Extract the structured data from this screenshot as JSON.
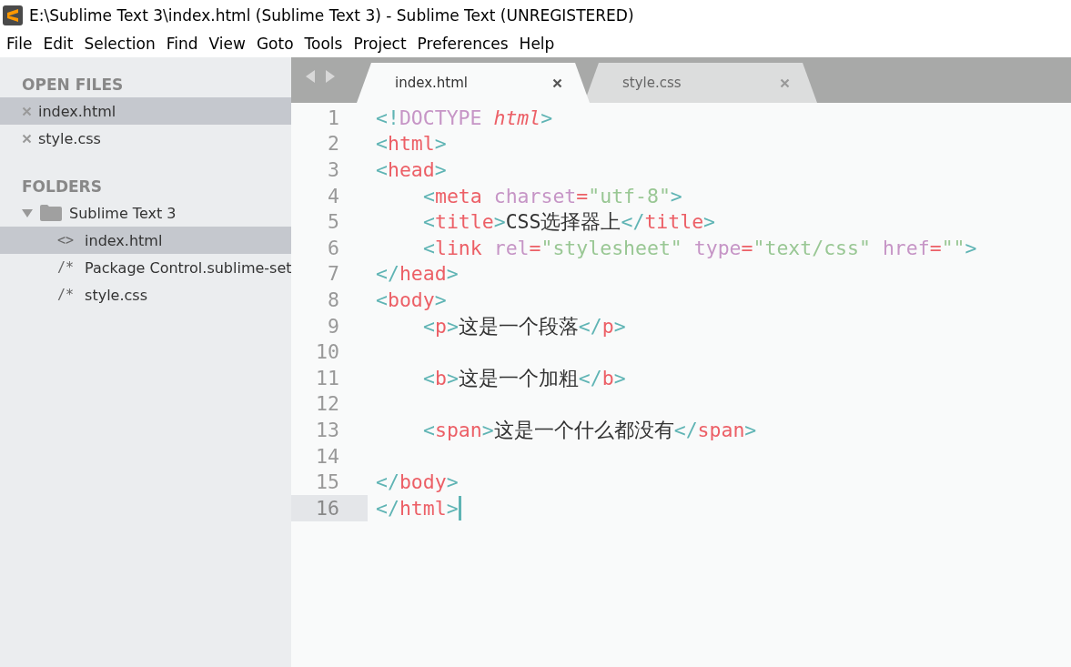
{
  "window": {
    "title": "E:\\Sublime Text 3\\index.html (Sublime Text 3) - Sublime Text (UNREGISTERED)"
  },
  "menu": [
    "File",
    "Edit",
    "Selection",
    "Find",
    "View",
    "Goto",
    "Tools",
    "Project",
    "Preferences",
    "Help"
  ],
  "sidebar": {
    "open_files": {
      "heading": "OPEN FILES",
      "items": [
        {
          "name": "index.html",
          "selected": true
        },
        {
          "name": "style.css",
          "selected": false
        }
      ]
    },
    "folders": {
      "heading": "FOLDERS",
      "items": [
        {
          "name": "Sublime Text 3",
          "expanded": true,
          "children": [
            {
              "name": "index.html",
              "icon": "<>",
              "selected": true
            },
            {
              "name": "Package Control.sublime-set",
              "icon": "/*",
              "selected": false
            },
            {
              "name": "style.css",
              "icon": "/*",
              "selected": false
            }
          ]
        }
      ]
    }
  },
  "tabs": [
    {
      "label": "index.html",
      "selected": true
    },
    {
      "label": "style.css",
      "selected": false
    }
  ],
  "editor": {
    "lines": [
      {
        "number": "1",
        "indented": false,
        "current": false,
        "tokens": [
          {
            "t": "<!",
            "kind": "punct"
          },
          {
            "t": "DOCTYPE ",
            "kind": "keyword"
          },
          {
            "t": "html",
            "kind": "italic"
          },
          {
            "t": ">",
            "kind": "punct"
          }
        ]
      },
      {
        "number": "2",
        "indented": false,
        "current": false,
        "tokens": [
          {
            "t": "<",
            "kind": "punct"
          },
          {
            "t": "html",
            "kind": "tag"
          },
          {
            "t": ">",
            "kind": "punct"
          }
        ]
      },
      {
        "number": "3",
        "indented": false,
        "current": false,
        "tokens": [
          {
            "t": "<",
            "kind": "punct"
          },
          {
            "t": "head",
            "kind": "tag"
          },
          {
            "t": ">",
            "kind": "punct"
          }
        ]
      },
      {
        "number": "4",
        "indented": true,
        "current": false,
        "tokens": [
          {
            "t": "<",
            "kind": "punct"
          },
          {
            "t": "meta ",
            "kind": "tag"
          },
          {
            "t": "charset",
            "kind": "attr"
          },
          {
            "t": "=",
            "kind": "tag"
          },
          {
            "t": "\"utf-8\"",
            "kind": "string"
          },
          {
            "t": ">",
            "kind": "punct"
          }
        ]
      },
      {
        "number": "5",
        "indented": true,
        "current": false,
        "tokens": [
          {
            "t": "<",
            "kind": "punct"
          },
          {
            "t": "title",
            "kind": "tag"
          },
          {
            "t": ">",
            "kind": "punct"
          },
          {
            "t": "CSS选择器上",
            "kind": "text"
          },
          {
            "t": "</",
            "kind": "punct"
          },
          {
            "t": "title",
            "kind": "tag"
          },
          {
            "t": ">",
            "kind": "punct"
          }
        ]
      },
      {
        "number": "6",
        "indented": true,
        "current": false,
        "tokens": [
          {
            "t": "<",
            "kind": "punct"
          },
          {
            "t": "link ",
            "kind": "tag"
          },
          {
            "t": "rel",
            "kind": "attr"
          },
          {
            "t": "=",
            "kind": "tag"
          },
          {
            "t": "\"stylesheet\" ",
            "kind": "string"
          },
          {
            "t": "type",
            "kind": "attr"
          },
          {
            "t": "=",
            "kind": "tag"
          },
          {
            "t": "\"text/css\" ",
            "kind": "string"
          },
          {
            "t": "href",
            "kind": "attr"
          },
          {
            "t": "=",
            "kind": "tag"
          },
          {
            "t": "\"\"",
            "kind": "string"
          },
          {
            "t": ">",
            "kind": "punct"
          }
        ]
      },
      {
        "number": "7",
        "indented": false,
        "current": false,
        "tokens": [
          {
            "t": "</",
            "kind": "punct"
          },
          {
            "t": "head",
            "kind": "tag"
          },
          {
            "t": ">",
            "kind": "punct"
          }
        ]
      },
      {
        "number": "8",
        "indented": false,
        "current": false,
        "tokens": [
          {
            "t": "<",
            "kind": "punct"
          },
          {
            "t": "body",
            "kind": "tag"
          },
          {
            "t": ">",
            "kind": "punct"
          }
        ]
      },
      {
        "number": "9",
        "indented": true,
        "current": false,
        "tokens": [
          {
            "t": "<",
            "kind": "punct"
          },
          {
            "t": "p",
            "kind": "tag"
          },
          {
            "t": ">",
            "kind": "punct"
          },
          {
            "t": "这是一个段落",
            "kind": "text"
          },
          {
            "t": "</",
            "kind": "punct"
          },
          {
            "t": "p",
            "kind": "tag"
          },
          {
            "t": ">",
            "kind": "punct"
          }
        ]
      },
      {
        "number": "10",
        "current": false
      },
      {
        "number": "11",
        "indented": true,
        "current": false,
        "tokens": [
          {
            "t": "<",
            "kind": "punct"
          },
          {
            "t": "b",
            "kind": "tag"
          },
          {
            "t": ">",
            "kind": "punct"
          },
          {
            "t": "这是一个加粗",
            "kind": "text"
          },
          {
            "t": "</",
            "kind": "punct"
          },
          {
            "t": "b",
            "kind": "tag"
          },
          {
            "t": ">",
            "kind": "punct"
          }
        ]
      },
      {
        "number": "12",
        "current": false
      },
      {
        "number": "13",
        "indented": true,
        "current": false,
        "tokens": [
          {
            "t": "<",
            "kind": "punct"
          },
          {
            "t": "span",
            "kind": "tag"
          },
          {
            "t": ">",
            "kind": "punct"
          },
          {
            "t": "这是一个什么都没有",
            "kind": "text"
          },
          {
            "t": "</",
            "kind": "punct"
          },
          {
            "t": "span",
            "kind": "tag"
          },
          {
            "t": ">",
            "kind": "punct"
          }
        ]
      },
      {
        "number": "14",
        "current": false
      },
      {
        "number": "15",
        "indented": false,
        "current": false,
        "tokens": [
          {
            "t": "</",
            "kind": "punct"
          },
          {
            "t": "body",
            "kind": "tag"
          },
          {
            "t": ">",
            "kind": "punct"
          }
        ]
      },
      {
        "number": "16",
        "indented": false,
        "current": true,
        "tokens": [
          {
            "t": "</",
            "kind": "punct"
          },
          {
            "t": "html",
            "kind": "tag"
          },
          {
            "t": ">",
            "kind": "punct"
          }
        ]
      }
    ]
  }
}
